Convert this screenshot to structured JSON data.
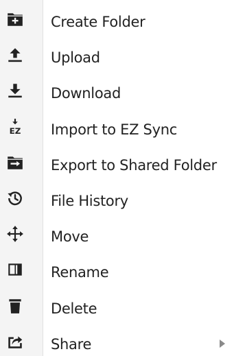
{
  "menu": {
    "items": [
      {
        "label": "Create Folder",
        "icon": "create-folder-icon"
      },
      {
        "label": "Upload",
        "icon": "upload-icon"
      },
      {
        "label": "Download",
        "icon": "download-icon"
      },
      {
        "label": "Import to EZ Sync",
        "icon": "import-ez-icon",
        "icon_text": "EZ"
      },
      {
        "label": "Export to Shared Folder",
        "icon": "export-folder-icon"
      },
      {
        "label": "File History",
        "icon": "history-icon"
      },
      {
        "label": "Move",
        "icon": "move-icon"
      },
      {
        "label": "Rename",
        "icon": "rename-icon"
      },
      {
        "label": "Delete",
        "icon": "trash-icon"
      },
      {
        "label": "Share",
        "icon": "share-icon",
        "has_submenu": true
      }
    ]
  },
  "colors": {
    "icon": "#222222",
    "text": "#222222",
    "gutter": "#f4f4f4",
    "submenu_arrow": "#8a8a8a"
  }
}
